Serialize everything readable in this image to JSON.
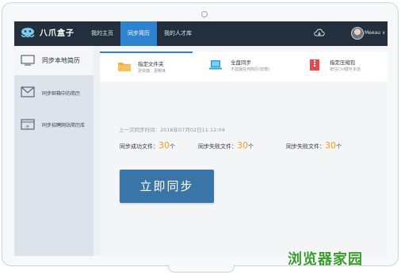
{
  "app": {
    "logo_text": "八爪盒子"
  },
  "nav": {
    "items": [
      {
        "label": "我的主页"
      },
      {
        "label": "同步简历"
      },
      {
        "label": "我的人才库"
      }
    ]
  },
  "user": {
    "name": "Meeau ∨"
  },
  "sidebar": {
    "items": [
      {
        "label": "同步本地简历",
        "icon": "monitor-icon"
      },
      {
        "label": "同步邮箱中的简历",
        "icon": "mail-icon"
      },
      {
        "label": "同步招聘网站简历库",
        "icon": "browser-icon"
      }
    ]
  },
  "tabs": [
    {
      "title": "指定文件夹",
      "subtitle": "更快捷、更精准",
      "icon": "folder-icon"
    },
    {
      "title": "全盘同步",
      "subtitle": "不遗漏任何简历(较慢)",
      "icon": "laptop-icon"
    },
    {
      "title": "指定压缩包",
      "subtitle": "按住Ctrl键可多选",
      "icon": "zip-icon"
    }
  ],
  "sync": {
    "last_time_label": "上一次同步时间：2018年07月02日11:12:04",
    "stats": [
      {
        "label": "同步成功文件：",
        "value": "30",
        "unit": "个"
      },
      {
        "label": "同步失败文件：",
        "value": "30",
        "unit": "个"
      },
      {
        "label": "同步失败文件：",
        "value": "30",
        "unit": "个"
      }
    ],
    "button_label": "立即同步"
  },
  "watermark": "浏览器家园",
  "colors": {
    "topbar": "#242f3d",
    "accent": "#2d83cf",
    "button": "#3a75a7",
    "count": "#f0a020"
  }
}
